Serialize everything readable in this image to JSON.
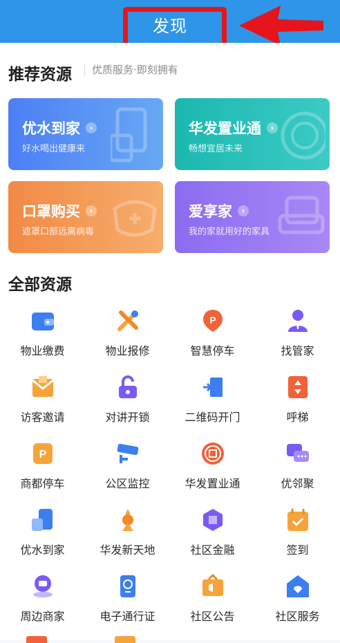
{
  "header": {
    "title": "发现"
  },
  "recommend": {
    "title": "推荐资源",
    "subtitle": "优质服务·即刻拥有",
    "cards": [
      {
        "title": "优水到家",
        "subtitle": "好水喝出健康来"
      },
      {
        "title": "华发置业通",
        "subtitle": "畅想宜居未来"
      },
      {
        "title": "口罩购买",
        "subtitle": "遮罩口部远离病毒"
      },
      {
        "title": "爱享家",
        "subtitle": "我的家就用好的家具"
      }
    ]
  },
  "all": {
    "title": "全部资源",
    "items": [
      {
        "label": "物业缴费",
        "icon": "wallet-icon"
      },
      {
        "label": "物业报修",
        "icon": "tools-icon"
      },
      {
        "label": "智慧停车",
        "icon": "parking-pin-icon"
      },
      {
        "label": "找管家",
        "icon": "butler-icon"
      },
      {
        "label": "访客邀请",
        "icon": "envelope-icon"
      },
      {
        "label": "对讲开锁",
        "icon": "lock-icon"
      },
      {
        "label": "二维码开门",
        "icon": "door-icon"
      },
      {
        "label": "呼梯",
        "icon": "elevator-icon"
      },
      {
        "label": "商都停车",
        "icon": "parking-tag-icon"
      },
      {
        "label": "公区监控",
        "icon": "camera-icon"
      },
      {
        "label": "华发置业通",
        "icon": "tong-icon"
      },
      {
        "label": "优邻聚",
        "icon": "chat-icon"
      },
      {
        "label": "优水到家",
        "icon": "water-icon"
      },
      {
        "label": "华发新天地",
        "icon": "landmark-icon"
      },
      {
        "label": "社区金融",
        "icon": "finance-icon"
      },
      {
        "label": "签到",
        "icon": "calendar-check-icon"
      },
      {
        "label": "周边商家",
        "icon": "shop-pin-icon"
      },
      {
        "label": "电子通行证",
        "icon": "pass-icon"
      },
      {
        "label": "社区公告",
        "icon": "announcement-icon"
      },
      {
        "label": "社区服务",
        "icon": "service-house-icon"
      }
    ]
  },
  "colors": {
    "header": "#2f95e8",
    "highlight": "#e6151c",
    "card_blue": [
      "#4d7ff5",
      "#67a8f3"
    ],
    "card_teal": [
      "#1bb8b0",
      "#3ccac6"
    ],
    "card_orange": [
      "#f28a45",
      "#f6ad6c"
    ],
    "card_purple": [
      "#8b6cf0",
      "#a888f5"
    ]
  }
}
